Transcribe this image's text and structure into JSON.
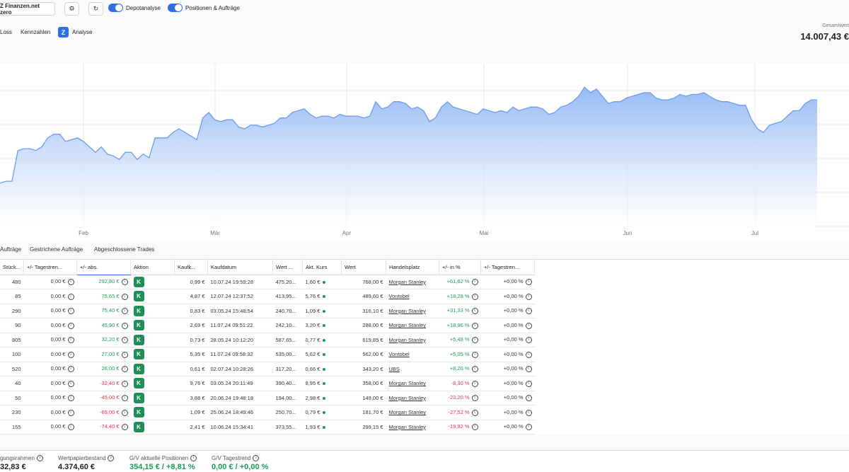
{
  "toolbar": {
    "account": "Z Finanzen.net zero",
    "toggle1": "Depotanalyse",
    "toggle2": "Positionen & Aufträge"
  },
  "subnav": {
    "item1": "Loss",
    "item2": "Kennzahlen",
    "item3": "Analyse"
  },
  "total": {
    "label": "Gesamtwert",
    "value": "14.007,43 €"
  },
  "chart_data": {
    "type": "area",
    "x_labels": [
      "Feb",
      "Mär",
      "Apr",
      "Mai",
      "Jun",
      "Jul"
    ],
    "values": [
      11.7,
      11.75,
      11.75,
      12.6,
      12.65,
      12.65,
      12.6,
      12.7,
      12.95,
      13.05,
      13.05,
      12.85,
      12.9,
      12.95,
      12.85,
      12.7,
      12.55,
      12.7,
      12.5,
      12.45,
      12.35,
      12.55,
      12.55,
      12.35,
      12.5,
      12.4,
      12.95,
      12.95,
      12.95,
      13.1,
      13.2,
      13.1,
      13.0,
      12.9,
      13.5,
      13.65,
      13.45,
      13.4,
      13.45,
      13.45,
      13.25,
      13.2,
      13.3,
      13.3,
      13.25,
      13.3,
      13.35,
      13.5,
      13.5,
      13.65,
      13.7,
      13.75,
      13.6,
      13.5,
      13.55,
      13.55,
      13.5,
      13.6,
      13.55,
      13.55,
      13.55,
      13.5,
      13.55,
      13.95,
      13.75,
      13.8,
      13.95,
      13.95,
      13.9,
      13.75,
      13.8,
      13.7,
      13.4,
      13.5,
      13.8,
      13.95,
      13.8,
      13.75,
      13.7,
      13.65,
      13.6,
      13.75,
      13.7,
      13.65,
      13.7,
      13.65,
      13.8,
      13.7,
      13.75,
      13.8,
      13.8,
      13.75,
      13.6,
      13.65,
      13.8,
      13.85,
      13.95,
      14.1,
      14.35,
      14.2,
      14.3,
      14.1,
      13.9,
      13.95,
      13.95,
      14.05,
      14.1,
      14.15,
      14.2,
      14.2,
      14.05,
      14.0,
      14.0,
      14.05,
      14.15,
      14.1,
      14.15,
      14.15,
      14.2,
      14.1,
      14.0,
      13.95,
      13.95,
      13.9,
      13.85,
      13.85,
      13.45,
      13.2,
      13.1,
      13.3,
      13.35,
      13.4,
      13.55,
      13.7,
      13.7,
      13.9,
      14.0,
      14.0
    ]
  },
  "order_tabs": [
    "Aufträge",
    "Gestrichene Aufträge",
    "Abgeschlossene Trades"
  ],
  "table": {
    "headers": [
      "Stück...",
      "+/- Tagestren...",
      "+/- abs.",
      "Aktion",
      "Kaufk...",
      "Kaufdatum",
      "Wert ...",
      "Akt. Kurs",
      "Wert",
      "Handelsplatz",
      "+/- in %",
      "+/- Tagestren..."
    ],
    "rows": [
      {
        "qty": "480",
        "day": "0,00 €",
        "abs": "292,80 €",
        "sign": "pos",
        "action": "K",
        "buy": "0,99 €",
        "date": "10.07.24 19:59:28",
        "wert1": "475,20...",
        "kurs": "1,60 €",
        "wert": "768,00 €",
        "venue": "Morgan Stanley",
        "pct": "+61,62 %",
        "daypct": "+0,00 %"
      },
      {
        "qty": "85",
        "day": "0,00 €",
        "abs": "75,65 €",
        "sign": "pos",
        "action": "K",
        "buy": "4,87 €",
        "date": "12.07.24 12:37:52",
        "wert1": "413,95...",
        "kurs": "5,76 €",
        "wert": "489,60 €",
        "venue": "Vontobel",
        "pct": "+18,28 %",
        "daypct": "+0,00 %"
      },
      {
        "qty": "290",
        "day": "0,00 €",
        "abs": "75,40 €",
        "sign": "pos",
        "action": "K",
        "buy": "0,83 €",
        "date": "03.05.24 15:48:54",
        "wert1": "240,70...",
        "kurs": "1,09 €",
        "wert": "316,10 €",
        "venue": "Morgan Stanley",
        "pct": "+31,33 %",
        "daypct": "+0,00 %"
      },
      {
        "qty": "90",
        "day": "0,00 €",
        "abs": "45,90 €",
        "sign": "pos",
        "action": "K",
        "buy": "2,69 €",
        "date": "11.07.24 09:51:22",
        "wert1": "242,10...",
        "kurs": "3,20 €",
        "wert": "288,00 €",
        "venue": "Morgan Stanley",
        "pct": "+18,96 %",
        "daypct": "+0,00 %"
      },
      {
        "qty": "805",
        "day": "0,00 €",
        "abs": "32,20 €",
        "sign": "pos",
        "action": "K",
        "buy": "0,73 €",
        "date": "28.05.24 10:12:20",
        "wert1": "587,65...",
        "kurs": "0,77 €",
        "wert": "619,85 €",
        "venue": "Morgan Stanley",
        "pct": "+5,48 %",
        "daypct": "+0,00 %"
      },
      {
        "qty": "100",
        "day": "0,00 €",
        "abs": "27,00 €",
        "sign": "pos",
        "action": "K",
        "buy": "5,35 €",
        "date": "11.07.24 09:58:32",
        "wert1": "535,00...",
        "kurs": "5,62 €",
        "wert": "562,00 €",
        "venue": "Vontobel",
        "pct": "+5,05 %",
        "daypct": "+0,00 %"
      },
      {
        "qty": "520",
        "day": "0,00 €",
        "abs": "26,00 €",
        "sign": "pos",
        "action": "K",
        "buy": "0,61 €",
        "date": "02.07.24 10:28:26",
        "wert1": "317,20...",
        "kurs": "0,66 €",
        "wert": "343,20 €",
        "venue": "UBS",
        "pct": "+8,20 %",
        "daypct": "+0,00 %"
      },
      {
        "qty": "40",
        "day": "0,00 €",
        "abs": "-32,40 €",
        "sign": "neg",
        "action": "K",
        "buy": "9,76 €",
        "date": "03.05.24 20:11:49",
        "wert1": "390,40...",
        "kurs": "8,95 €",
        "wert": "358,00 €",
        "venue": "Morgan Stanley",
        "pct": "-8,30 %",
        "daypct": "+0,00 %"
      },
      {
        "qty": "50",
        "day": "0,00 €",
        "abs": "-45,00 €",
        "sign": "neg",
        "action": "K",
        "buy": "3,88 €",
        "date": "20.06.24 19:48:18",
        "wert1": "194,00...",
        "kurs": "2,98 €",
        "wert": "149,00 €",
        "venue": "Morgan Stanley",
        "pct": "-23,20 %",
        "daypct": "+0,00 %"
      },
      {
        "qty": "230",
        "day": "0,00 €",
        "abs": "-69,00 €",
        "sign": "neg",
        "action": "K",
        "buy": "1,09 €",
        "date": "25.06.24 18:49:46",
        "wert1": "250,70...",
        "kurs": "0,79 €",
        "wert": "181,70 €",
        "venue": "Morgan Stanley",
        "pct": "-27,52 %",
        "daypct": "+0,00 %"
      },
      {
        "qty": "155",
        "day": "0,00 €",
        "abs": "-74,40 €",
        "sign": "neg",
        "action": "K",
        "buy": "2,41 €",
        "date": "10.06.24 15:34:41",
        "wert1": "373,55...",
        "kurs": "1,93 €",
        "wert": "299,15 €",
        "venue": "Morgan Stanley",
        "pct": "-19,92 %",
        "daypct": "+0,00 %"
      }
    ]
  },
  "footer": {
    "f1_label": "gungsrahmen",
    "f1_value": "32,83 €",
    "f2_label": "Wertpapierbestand",
    "f2_value": "4.374,60 €",
    "f3_label": "G/V aktuelle Positionen",
    "f3_value": "354,15 € / +8,81 %",
    "f4_label": "G/V Tagestrend",
    "f4_value": "0,00 € / +0,00 %"
  },
  "colors": {
    "accent": "#2f6fe4",
    "positive": "#1a9b58",
    "negative": "#e0344a",
    "area_fill": "#8fb6f3"
  }
}
